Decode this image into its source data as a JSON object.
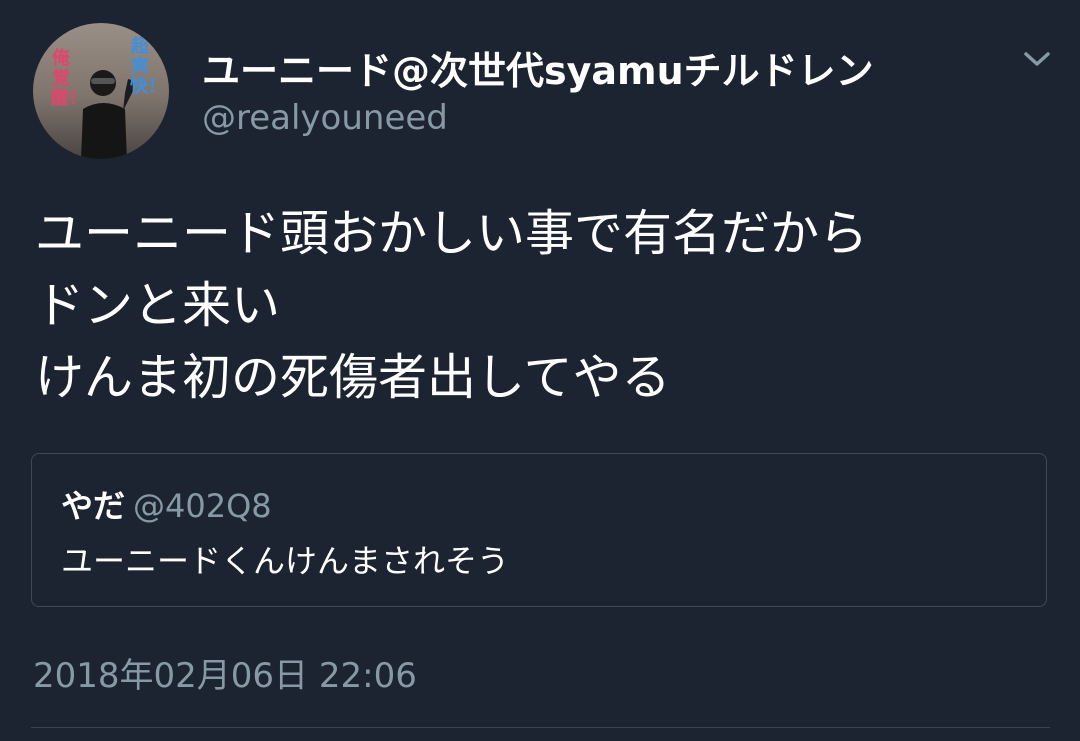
{
  "author": {
    "display_name": "ユーニード@次世代syamuチルドレン",
    "handle": "@realyouneed",
    "avatar_text_left": "俺覚醒！",
    "avatar_text_right": "超爽快！"
  },
  "tweet": {
    "lines": [
      "ユーニード頭おかしい事で有名だから",
      "ドンと来い",
      "けんま初の死傷者出してやる"
    ],
    "timestamp": "2018年02月06日 22:06"
  },
  "quoted_tweet": {
    "display_name": "やだ",
    "handle": "@402Q8",
    "text": "ユーニードくんけんまされそう"
  },
  "icons": {
    "menu": "chevron-down-icon"
  },
  "colors": {
    "background": "#1b2430",
    "text": "#ffffff",
    "secondary_text": "#8899a6",
    "border": "#3d4a57"
  }
}
